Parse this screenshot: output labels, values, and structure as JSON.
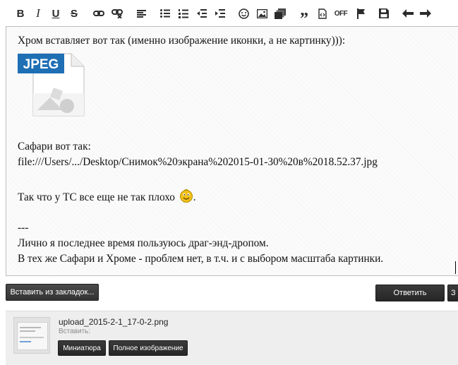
{
  "toolbar": {
    "buttons": [
      {
        "name": "bold-button",
        "icon": "bold-icon",
        "glyph": "B"
      },
      {
        "name": "italic-button",
        "icon": "italic-icon",
        "glyph": "I"
      },
      {
        "name": "underline-button",
        "icon": "underline-icon",
        "glyph": "U"
      },
      {
        "name": "strikethrough-button",
        "icon": "strikethrough-icon",
        "glyph": "S"
      },
      {
        "name": "link-button",
        "icon": "link-icon"
      },
      {
        "name": "unlink-button",
        "icon": "unlink-icon"
      },
      {
        "name": "align-button",
        "icon": "align-left-icon"
      },
      {
        "name": "bullet-list-button",
        "icon": "bullet-list-icon"
      },
      {
        "name": "numbered-list-button",
        "icon": "numbered-list-icon"
      },
      {
        "name": "outdent-button",
        "icon": "outdent-icon"
      },
      {
        "name": "indent-button",
        "icon": "indent-icon"
      },
      {
        "name": "smilie-button",
        "icon": "smiley-icon"
      },
      {
        "name": "image-button",
        "icon": "image-icon"
      },
      {
        "name": "media-button",
        "icon": "media-icon"
      },
      {
        "name": "quote-button",
        "icon": "quote-icon"
      },
      {
        "name": "code-button",
        "icon": "code-icon"
      },
      {
        "name": "off-button",
        "icon": "off-icon",
        "glyph": "OFF"
      },
      {
        "name": "flag-button",
        "icon": "flag-icon"
      },
      {
        "name": "save-draft-button",
        "icon": "save-icon"
      },
      {
        "name": "undo-button",
        "icon": "undo-icon"
      },
      {
        "name": "redo-button",
        "icon": "redo-icon"
      }
    ]
  },
  "editor": {
    "line1": "Хром вставляет вот так (именно изображение иконки, а не картинку))):",
    "jpeg_label": "JPEG",
    "line_safari": "Сафари вот так:",
    "line_path": "file:///Users/.../Desktop/Снимок%20экрана%202015-01-30%20в%2018.52.37.jpg",
    "line_ts": "Так что у ТС все еще не так плохо",
    "line_ts_end": ".",
    "line_dashes": "---",
    "line_personal": "Лично я последнее время пользуюсь драг-энд-дропом.",
    "line_same": "В тех же Сафари и Хроме - проблем нет, в т.ч. и с выбором масштаба картинки."
  },
  "actions": {
    "bookmarks_label": "Вставить из закладок...",
    "reply_label": "Ответить",
    "extra_label": "З"
  },
  "attachment": {
    "file_name": "upload_2015-2-1_17-0-2.png",
    "insert_label": "Вставить:",
    "thumbnail_button": "Миниатюра",
    "full_image_button": "Полное изображение"
  },
  "colors": {
    "button_dark": "#2f2f2f",
    "jpeg_badge": "#1f6fb5",
    "smiley": "#f2c21a"
  }
}
